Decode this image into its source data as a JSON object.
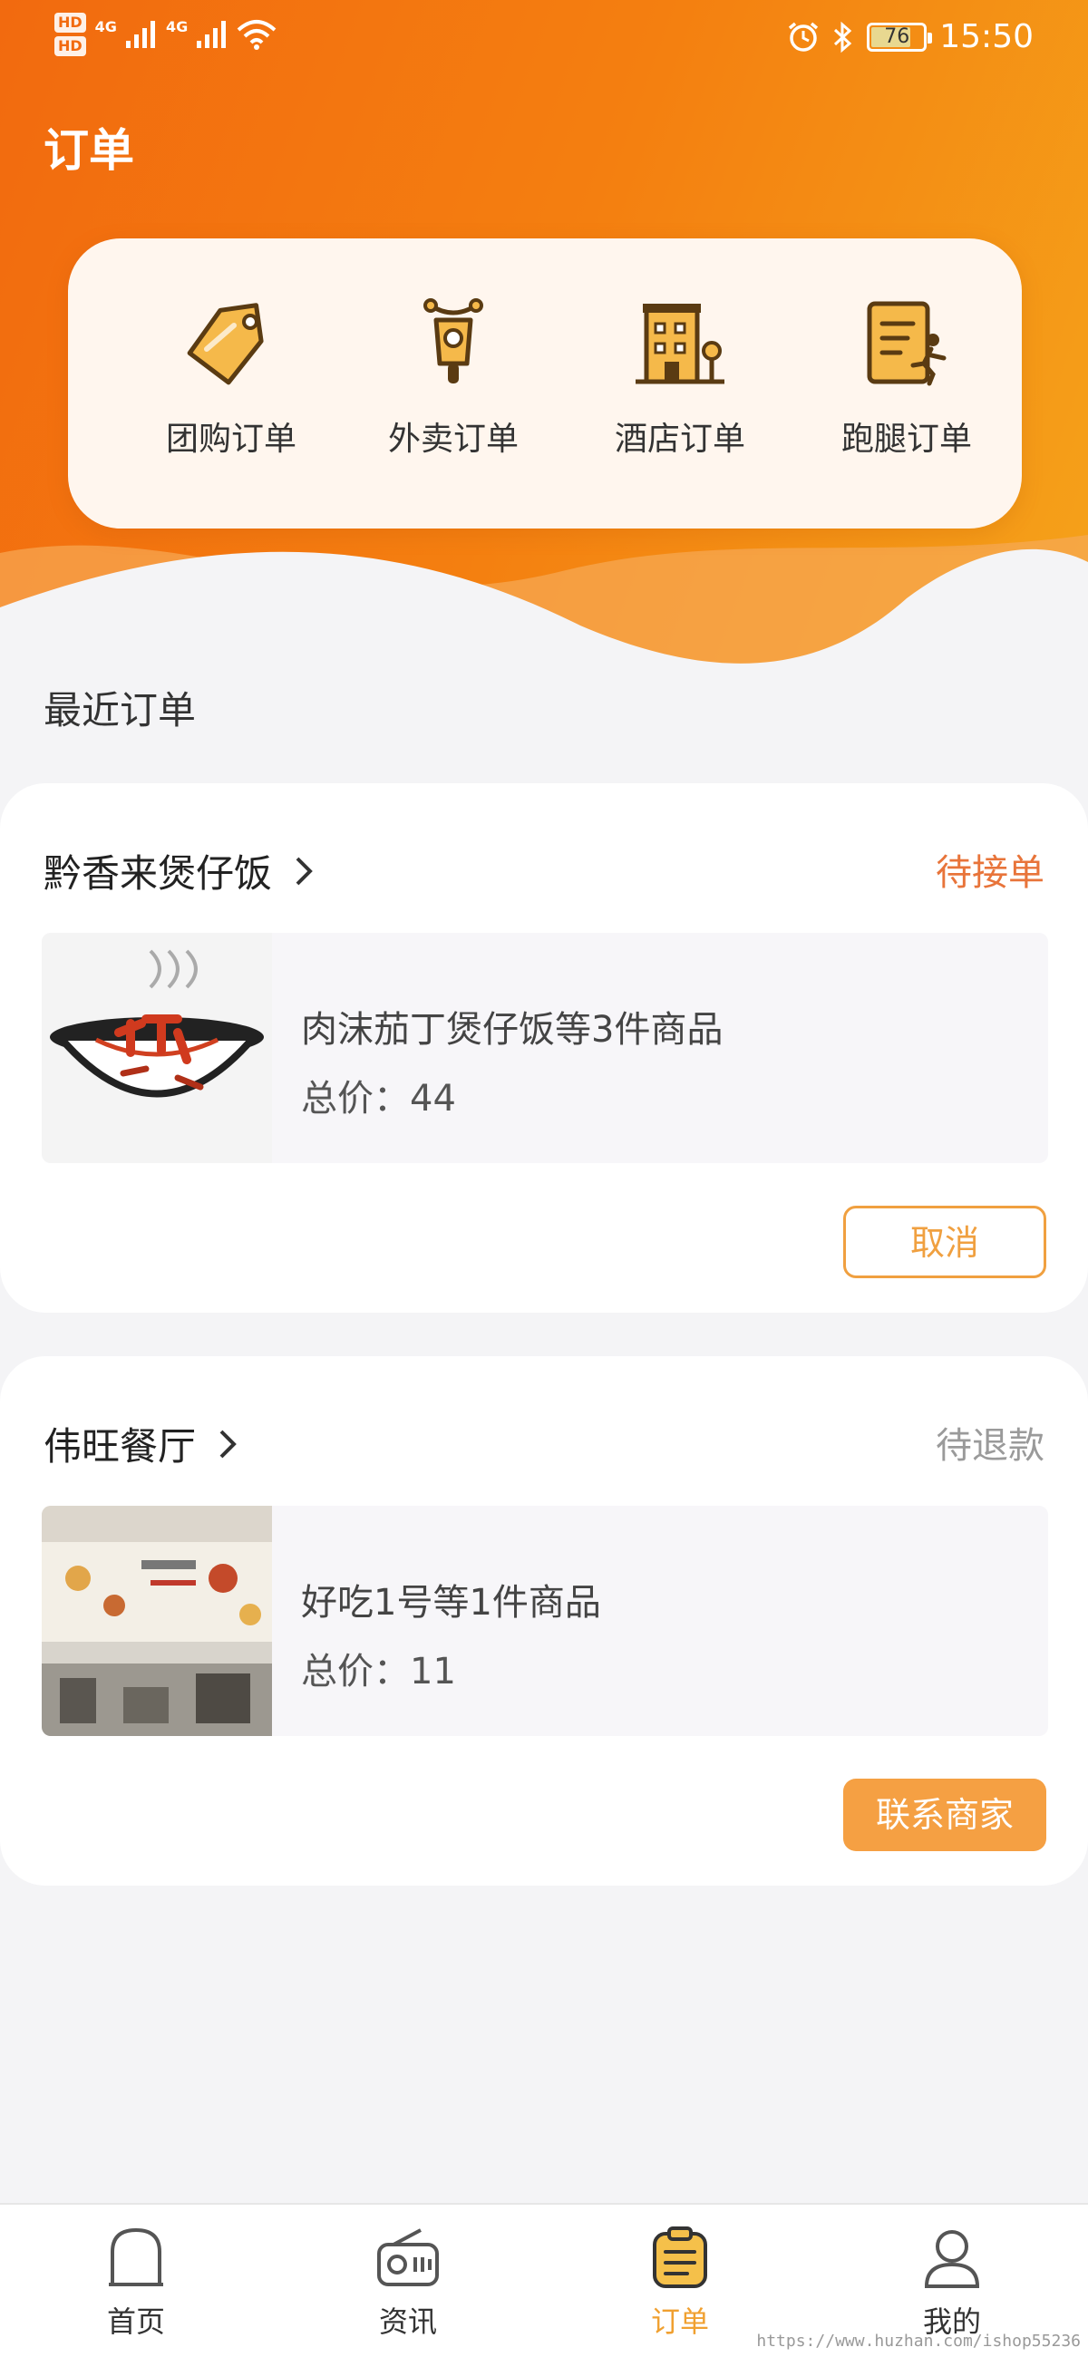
{
  "status_bar": {
    "hd1": "HD",
    "hd2": "HD",
    "net1": "4G",
    "net2": "4G",
    "battery": "76",
    "time": "15:50"
  },
  "header": {
    "title": "订单"
  },
  "quick_entries": [
    {
      "label": "团购订单",
      "icon": "tag-icon"
    },
    {
      "label": "外卖订单",
      "icon": "scooter-icon"
    },
    {
      "label": "酒店订单",
      "icon": "hotel-icon"
    },
    {
      "label": "跑腿订单",
      "icon": "errand-icon"
    }
  ],
  "recent": {
    "title": "最近订单"
  },
  "orders": [
    {
      "store": "黔香来煲仔饭",
      "status": "待接单",
      "summary": "肉沫茄丁煲仔饭等3件商品",
      "price": "总价：44",
      "action": "取消",
      "status_color": "#e8743a"
    },
    {
      "store": "伟旺餐厅",
      "status": "待退款",
      "summary": "好吃1号等1件商品",
      "price": "总价：11",
      "action": "联系商家",
      "status_color": "#9a9a9a"
    }
  ],
  "tabbar": {
    "items": [
      {
        "label": "首页",
        "icon": "home-icon"
      },
      {
        "label": "资讯",
        "icon": "radio-icon"
      },
      {
        "label": "订单",
        "icon": "order-icon",
        "active": true
      },
      {
        "label": "我的",
        "icon": "user-icon"
      }
    ]
  },
  "watermark": "https://www.huzhan.com/ishop55236",
  "colors": {
    "brand": "#f47f10",
    "accent": "#f0a040"
  }
}
